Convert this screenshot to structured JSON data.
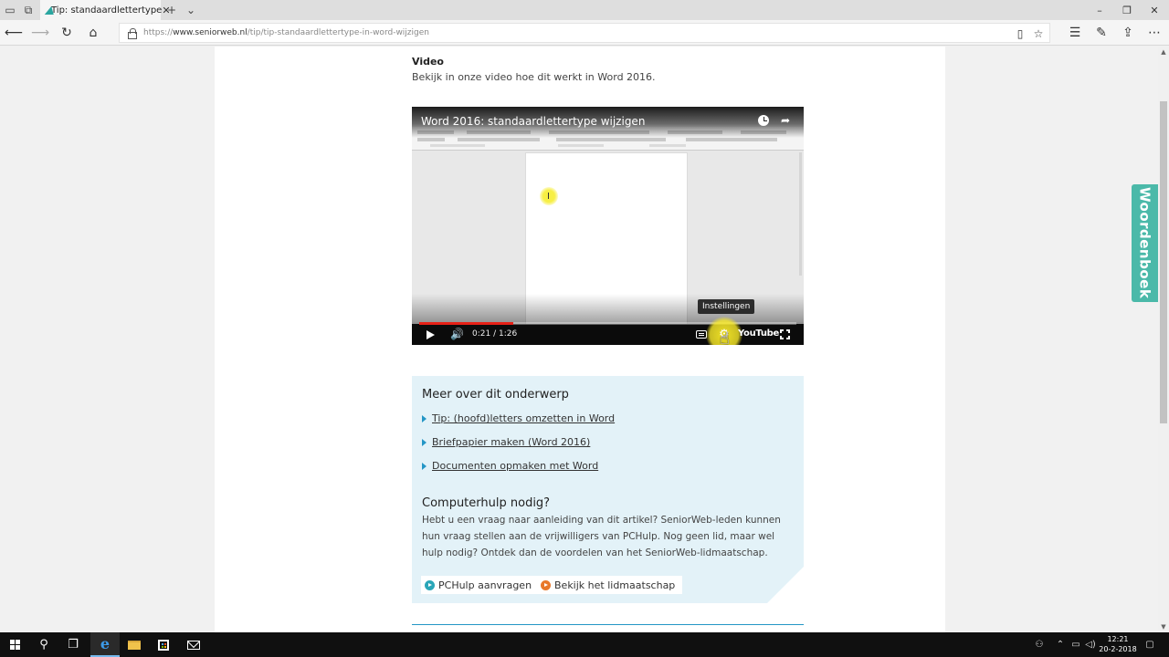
{
  "browser": {
    "tab_title": "Tip: standaardlettertype",
    "tab_close": "✕",
    "new_tab": "+",
    "tab_menu": "⌄",
    "url_prefix": "https://",
    "url_domain": "www.seniorweb.nl",
    "url_path": "/tip/tip-standaardlettertype-in-word-wijzigen",
    "window_controls": {
      "minimize": "–",
      "restore": "❐",
      "close": "✕"
    }
  },
  "article": {
    "video_heading": "Video",
    "video_intro": "Bekijk in onze video hoe dit werkt in Word 2016."
  },
  "video": {
    "title": "Word 2016: standaardlettertype wijzigen",
    "time": "0:21 / 1:26",
    "progress": 0.25,
    "buffered": 0.25,
    "tooltip": "Instellingen",
    "logo": "YouTube",
    "share_glyph": "➦",
    "settings_glyph": "⚙",
    "volume_glyph": "🔊",
    "pointer_glyph": "☝"
  },
  "infobox": {
    "more_heading": "Meer over dit onderwerp",
    "links": [
      "Tip: (hoofd)letters omzetten in Word",
      "Briefpapier maken (Word 2016)",
      "Documenten opmaken met Word"
    ],
    "help_heading": "Computerhulp nodig?",
    "help_text": "Hebt u een vraag naar aanleiding van dit artikel? SeniorWeb-leden kunnen hun vraag stellen aan de vrijwilligers van PCHulp. Nog geen lid, maar wel hulp nodig? Ontdek dan de voordelen van het SeniorWeb-lidmaatschap.",
    "button_pchulp": "PCHulp aanvragen",
    "button_lidmaatschap": "Bekijk het lidmaatschap"
  },
  "side_tab": {
    "label": "Woordenboek"
  },
  "taskbar": {
    "time": "12:21",
    "date": "20-2-2018"
  },
  "colors": {
    "accent_blue": "#2496c6",
    "side_tab_green": "#4bb9a9",
    "infobox_bg": "#e3f2f8",
    "yt_red": "#e62117",
    "orange": "#e8782b",
    "teal": "#2aa6b8"
  }
}
